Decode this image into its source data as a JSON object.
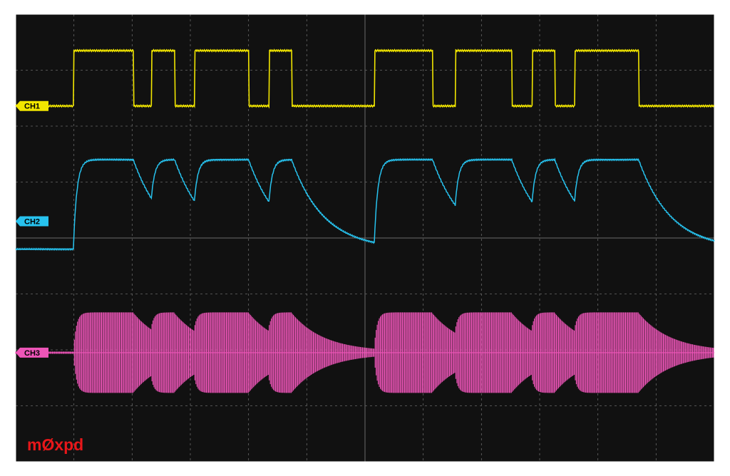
{
  "chart_data": {
    "type": "line",
    "title": "",
    "xlabel": "",
    "ylabel": "",
    "grid": true,
    "grid_divisions": {
      "horizontal": 12,
      "vertical": 8
    },
    "x_unit": "horizontal divisions",
    "y_unit": "vertical divisions",
    "xlim": [
      0,
      12
    ],
    "ylim": [
      0,
      8
    ],
    "background_color": "#111111",
    "grid_color": "#6a6a6a",
    "series": [
      {
        "name": "CH1",
        "color": "#f2e600",
        "style": "digital",
        "ground": 6.36,
        "low": 6.36,
        "high": 7.35,
        "transitions": [
          1.0,
          2.03,
          2.33,
          2.73,
          3.07,
          4.0,
          4.35,
          4.74,
          6.16,
          7.16,
          7.55,
          8.52,
          8.87,
          9.26,
          9.6,
          10.7,
          12.0
        ],
        "start_level": "low"
      },
      {
        "name": "CH2",
        "color": "#27c2ee",
        "style": "rc",
        "ground": 4.3,
        "low": 3.8,
        "high": 5.4,
        "tau_rise": 0.06,
        "tau_fall": 0.55,
        "transitions": [
          1.0,
          2.03,
          2.33,
          2.73,
          3.07,
          4.0,
          4.35,
          4.74,
          6.16,
          7.16,
          7.55,
          8.52,
          8.87,
          9.26,
          9.6,
          10.7,
          12.0
        ],
        "start_level": "low"
      },
      {
        "name": "CH3",
        "color": "#ee55b8",
        "style": "envelope",
        "ground": 1.95,
        "amplitude_max": 0.72,
        "amplitude_min": 0.02,
        "tau_rise": 0.05,
        "tau_fall": 0.55,
        "transitions": [
          1.0,
          2.03,
          2.33,
          2.73,
          3.07,
          4.0,
          4.35,
          4.74,
          6.16,
          7.16,
          7.55,
          8.52,
          8.87,
          9.26,
          9.6,
          10.7,
          12.0
        ],
        "start_level": "low"
      }
    ]
  },
  "watermark": {
    "text": "mØxpd",
    "color": "#e8171a"
  }
}
